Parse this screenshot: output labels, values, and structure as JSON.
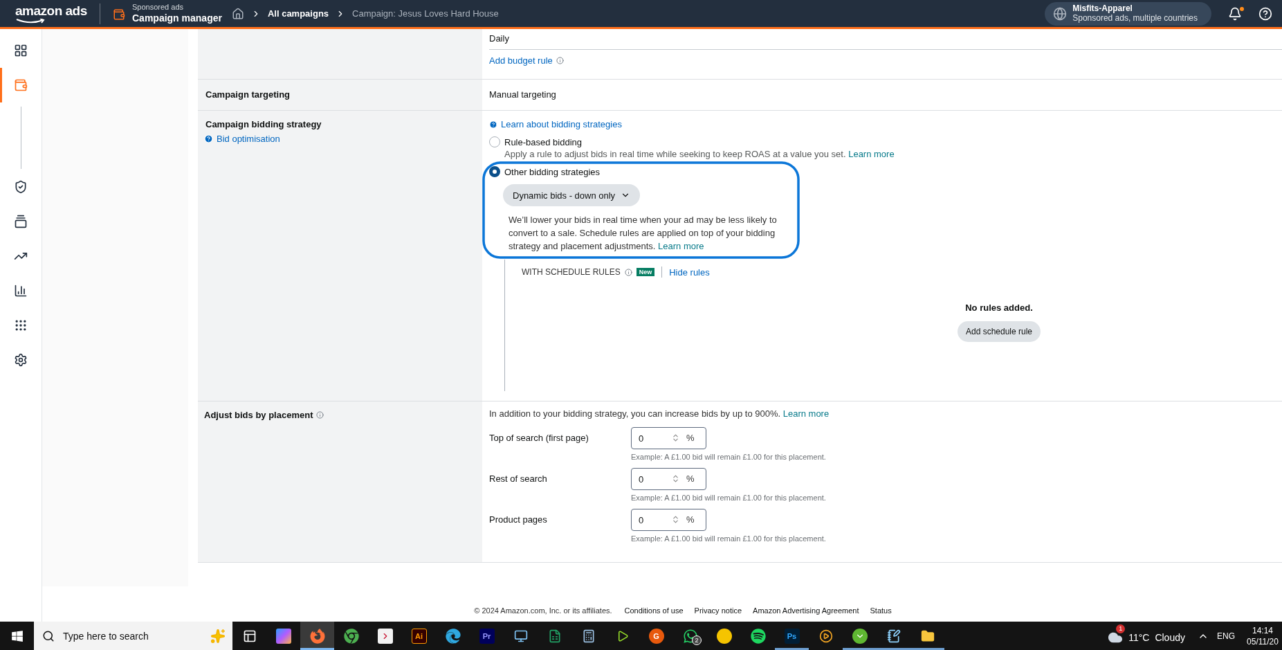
{
  "top_bar": {
    "logo": "amazon ads",
    "product_overline": "Sponsored ads",
    "product": "Campaign manager",
    "breadcrumbs": [
      {
        "label": "All campaigns",
        "current": false
      },
      {
        "label": "Campaign: Jesus Loves Hard House",
        "current": true
      }
    ],
    "account": {
      "name": "Misfits-Apparel",
      "subtitle": "Sponsored ads, multiple countries"
    },
    "notifications_unread": true
  },
  "sidebar": {
    "items": [
      {
        "kind": "dashboard",
        "selected": false
      },
      {
        "kind": "campaigns",
        "selected": true
      },
      {
        "kind": "shield",
        "selected": false
      },
      {
        "kind": "gallery",
        "selected": false
      },
      {
        "kind": "trend",
        "selected": false
      },
      {
        "kind": "reports",
        "selected": false
      },
      {
        "kind": "apps",
        "selected": false
      },
      {
        "kind": "settings",
        "selected": false
      }
    ]
  },
  "budget": {
    "value": "Daily",
    "link": "Add budget rule"
  },
  "targeting": {
    "label": "Campaign targeting",
    "value": "Manual targeting"
  },
  "bidding": {
    "label": "Campaign bidding strategy",
    "help_link": "Bid optimisation",
    "learn_link": "Learn about bidding strategies",
    "options": [
      {
        "label": "Rule-based bidding",
        "selected": false,
        "description": "Apply a rule to adjust bids in real time while seeking to keep ROAS at a value you set.",
        "link": "Learn more"
      },
      {
        "label": "Other bidding strategies",
        "selected": true,
        "strategy": "Dynamic bids - down only",
        "note": "We’ll lower your bids in real time when your ad may be less likely to convert to a sale. Schedule rules are applied on top of your bidding strategy and placement adjustments.",
        "note_link": "Learn more"
      }
    ],
    "schedule": {
      "title": "WITH SCHEDULE RULES",
      "badge": "New",
      "toggle": "Hide rules",
      "empty": "No rules added.",
      "button": "Add schedule rule"
    }
  },
  "placement": {
    "label": "Adjust bids by placement",
    "intro": "In addition to your bidding strategy, you can increase bids by up to 900%.",
    "link": "Learn more",
    "rows": [
      {
        "label": "Top of search (first page)",
        "value": "0",
        "unit": "%",
        "example": "Example: A £1.00 bid will remain £1.00 for this placement."
      },
      {
        "label": "Rest of search",
        "value": "0",
        "unit": "%",
        "example": "Example: A £1.00 bid will remain £1.00 for this placement."
      },
      {
        "label": "Product pages",
        "value": "0",
        "unit": "%",
        "example": "Example: A £1.00 bid will remain £1.00 for this placement."
      }
    ]
  },
  "footer": {
    "copyright": "© 2024 Amazon.com, Inc. or its affiliates.",
    "links": [
      "Conditions of use",
      "Privacy notice",
      "Amazon Advertising Agreement",
      "Status"
    ]
  },
  "taskbar": {
    "search_placeholder": "Type here to search",
    "apps": [
      {
        "kind": "task-view",
        "open": false,
        "selected": false
      },
      {
        "kind": "copilot",
        "open": false,
        "selected": false
      },
      {
        "kind": "firefox",
        "open": true,
        "selected": true
      },
      {
        "kind": "chrome",
        "open": false,
        "selected": false
      },
      {
        "kind": "red-tile",
        "open": false,
        "selected": false
      },
      {
        "kind": "letter-tile",
        "label": "Ai",
        "open": false,
        "selected": false
      },
      {
        "kind": "edge",
        "open": false,
        "selected": false
      },
      {
        "kind": "letter-tile",
        "label": "Pr",
        "open": false,
        "selected": false
      },
      {
        "kind": "computer",
        "open": false,
        "selected": false
      },
      {
        "kind": "excel",
        "open": false,
        "selected": false
      },
      {
        "kind": "calculator",
        "open": false,
        "selected": false
      },
      {
        "kind": "green-play",
        "open": false,
        "selected": false
      },
      {
        "kind": "letter-circle",
        "label": "G",
        "open": false,
        "selected": false
      },
      {
        "kind": "whatsapp",
        "badge": "2",
        "open": false,
        "selected": false
      },
      {
        "kind": "yellow-circle",
        "open": false,
        "selected": false
      },
      {
        "kind": "spotify",
        "open": false,
        "selected": false
      },
      {
        "kind": "letter-tile",
        "label": "Ps",
        "open": true,
        "selected": false
      },
      {
        "kind": "video",
        "open": false,
        "selected": false
      },
      {
        "kind": "torrent",
        "open": true,
        "selected": false
      },
      {
        "kind": "notepad",
        "open": true,
        "selected": false
      },
      {
        "kind": "folder",
        "open": true,
        "selected": false
      }
    ],
    "weather": {
      "badge": "1",
      "temperature": "11°C",
      "condition": "Cloudy"
    },
    "language": "ENG",
    "time": "14:14",
    "date": "05/11/20"
  }
}
